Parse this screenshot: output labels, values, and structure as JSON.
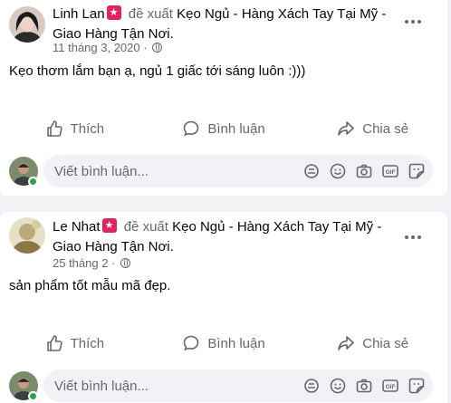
{
  "posts": [
    {
      "author": "Linh Lan",
      "verb": "đề xuất",
      "page_title_line1": "Kẹo Ngủ - Hàng Xách Tay Tại Mỹ -",
      "page_title_line2": "Giao Hàng Tận Nơi.",
      "date": "11 tháng 3, 2020 ·",
      "text": "Kẹo thơm lắm bạn ạ, ngủ 1 giấc tới sáng luôn :)))"
    },
    {
      "author": "Le Nhat",
      "verb": "đề xuất",
      "page_title_line1": "Kẹo Ngủ - Hàng Xách Tay Tại Mỹ -",
      "page_title_line2": "Giao Hàng Tận Nơi.",
      "date": "25 tháng 2 ·",
      "text": "sản phẩm tốt mẫu mã đẹp."
    }
  ],
  "actions": {
    "like": "Thích",
    "comment": "Bình luận",
    "share": "Chia sẻ"
  },
  "comment_box": {
    "placeholder": "Viết bình luận..."
  },
  "icons": [
    "more-icon",
    "like-icon",
    "comment-icon",
    "share-icon",
    "avatar-sticker-icon",
    "emoji-icon",
    "camera-icon",
    "gif-icon",
    "sticker-icon",
    "globe-icon",
    "recommend-badge-icon"
  ],
  "colors": {
    "badge": "#e0245e",
    "online": "#31a24c",
    "secondary_text": "#65676b",
    "input_bg": "#f0f2f5"
  }
}
